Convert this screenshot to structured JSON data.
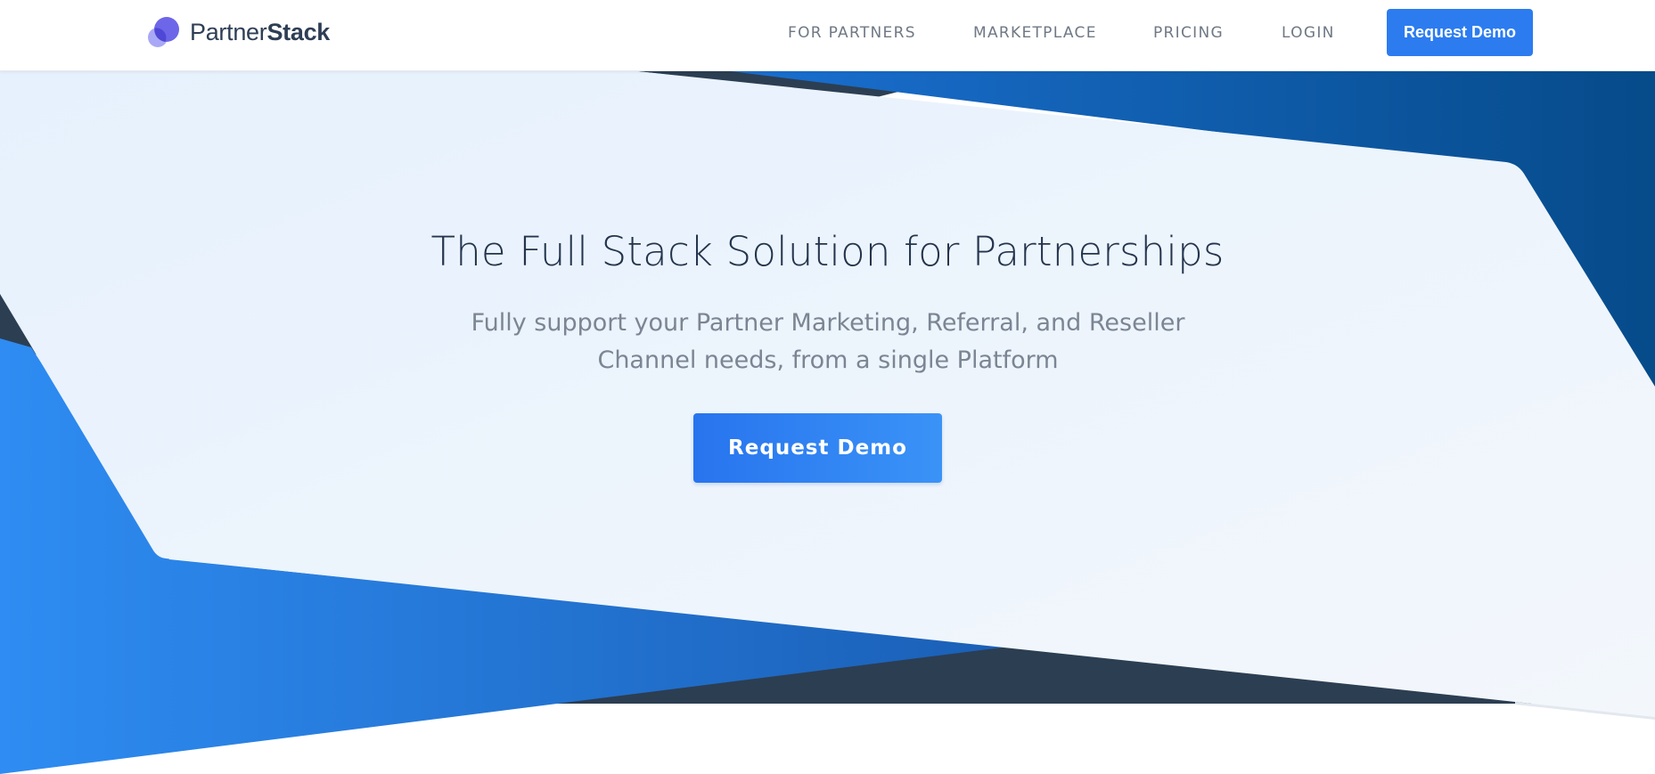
{
  "brand": {
    "name_light": "Partner",
    "name_bold": "Stack",
    "logo_icon": "overlapping-circles-logo"
  },
  "nav": {
    "links": [
      {
        "label": "FOR PARTNERS"
      },
      {
        "label": "MARKETPLACE"
      },
      {
        "label": "PRICING"
      },
      {
        "label": "LOGIN"
      }
    ],
    "cta_label": "Request Demo"
  },
  "hero": {
    "title": "The Full Stack Solution for Partnerships",
    "subtitle": "Fully support your Partner Marketing, Referral, and Reseller Channel needs, from a single Platform",
    "cta_label": "Request Demo"
  },
  "colors": {
    "accent": "#2c7cf0",
    "navy": "#2c3e52",
    "panel": "#eef5fd",
    "text_dark": "#24344d",
    "text_muted": "#7b8593"
  }
}
